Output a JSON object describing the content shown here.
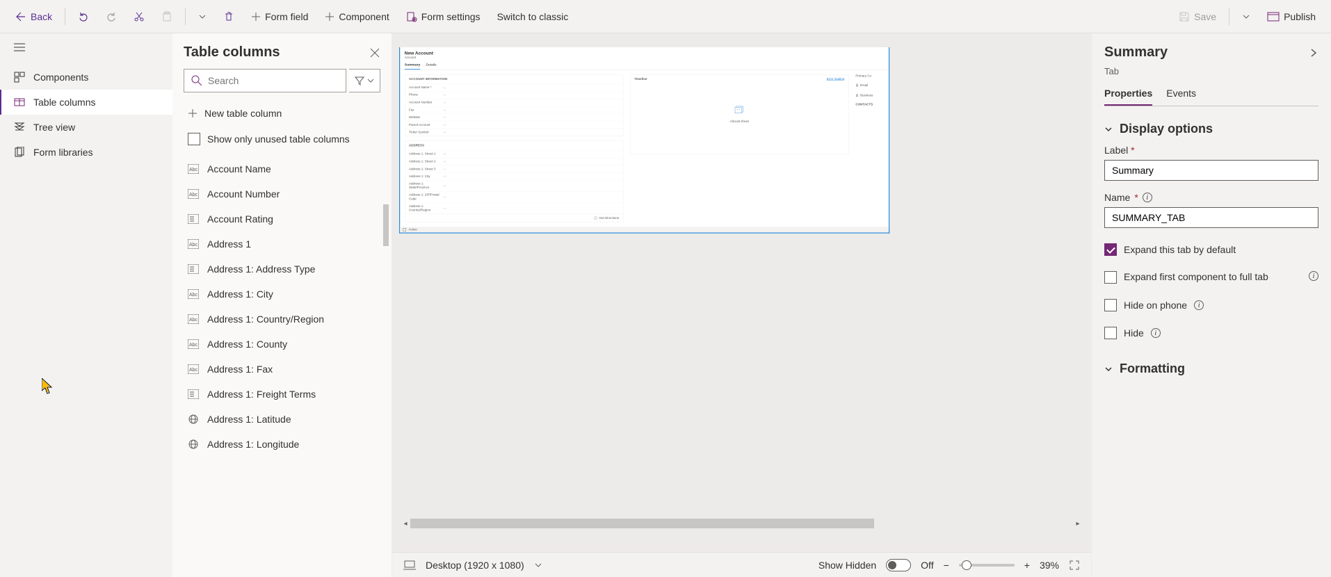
{
  "toolbar": {
    "back": "Back",
    "form_field": "Form field",
    "component": "Component",
    "form_settings": "Form settings",
    "switch_classic": "Switch to classic",
    "save": "Save",
    "publish": "Publish"
  },
  "left_nav": {
    "components": "Components",
    "table_columns": "Table columns",
    "tree_view": "Tree view",
    "form_libraries": "Form libraries"
  },
  "columns_panel": {
    "title": "Table columns",
    "search_placeholder": "Search",
    "new_column": "New table column",
    "show_unused": "Show only unused table columns",
    "items": [
      "Account Name",
      "Account Number",
      "Account Rating",
      "Address 1",
      "Address 1: Address Type",
      "Address 1: City",
      "Address 1: Country/Region",
      "Address 1: County",
      "Address 1: Fax",
      "Address 1: Freight Terms",
      "Address 1: Latitude",
      "Address 1: Longitude"
    ]
  },
  "form": {
    "title": "New Account",
    "entity": "Account",
    "tabs": [
      "Summary",
      "Details"
    ],
    "section_account": "ACCOUNT INFORMATION",
    "section_address": "ADDRESS",
    "fields1": [
      {
        "label": "Account Name",
        "req": true
      },
      {
        "label": "Phone"
      },
      {
        "label": "Account Number"
      },
      {
        "label": "Fax"
      },
      {
        "label": "Website"
      },
      {
        "label": "Parent Account"
      },
      {
        "label": "Ticker Symbol"
      }
    ],
    "fields2": [
      {
        "label": "Address 1: Street 1"
      },
      {
        "label": "Address 1: Street 2"
      },
      {
        "label": "Address 1: Street 3"
      },
      {
        "label": "Address 1: City"
      },
      {
        "label": "Address 1: State/Province"
      },
      {
        "label": "Address 1: ZIP/Postal Code"
      },
      {
        "label": "Address 1: Country/Region"
      }
    ],
    "get_directions": "Get Directions",
    "timeline": "Timeline",
    "almost_there": "Almost there",
    "error_loading": "Error loading",
    "rail": {
      "primary": "Primary Co",
      "email": "Email",
      "business": "Business",
      "contacts": "CONTACTS"
    },
    "status": "Active"
  },
  "canvas_footer": {
    "device_label": "Desktop (1920 x 1080)",
    "show_hidden": "Show Hidden",
    "toggle_label": "Off",
    "zoom": "39%"
  },
  "props": {
    "title": "Summary",
    "subtitle": "Tab",
    "tabs": [
      "Properties",
      "Events"
    ],
    "display_options": "Display options",
    "label_label": "Label",
    "label_value": "Summary",
    "name_label": "Name",
    "name_value": "SUMMARY_TAB",
    "expand_default": "Expand this tab by default",
    "expand_first": "Expand first component to full tab",
    "hide_phone": "Hide on phone",
    "hide": "Hide",
    "formatting": "Formatting"
  }
}
